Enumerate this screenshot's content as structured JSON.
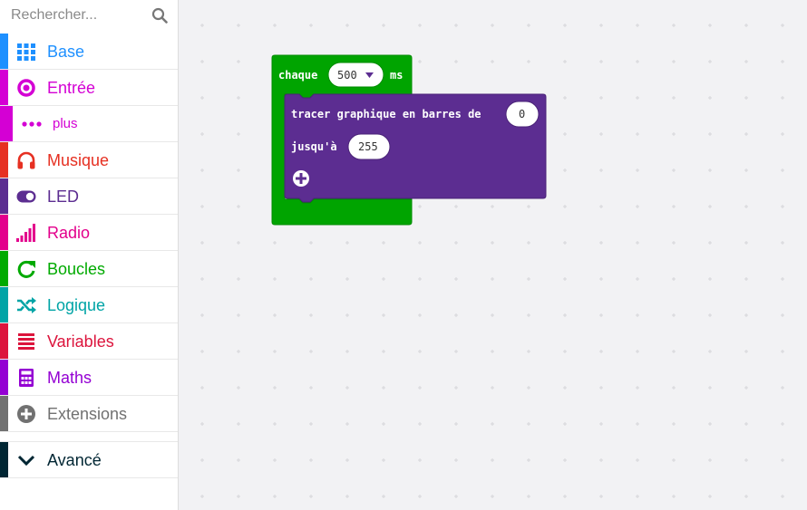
{
  "search": {
    "placeholder": "Rechercher..."
  },
  "categories": [
    {
      "label": "Base",
      "color": "#1e90ff",
      "icon": "grid-icon"
    },
    {
      "label": "Entrée",
      "color": "#d400d4",
      "icon": "target-icon"
    },
    {
      "label": "plus",
      "color": "#d400d4",
      "icon": "more-dots-icon"
    },
    {
      "label": "Musique",
      "color": "#e63022",
      "icon": "headphones-icon"
    },
    {
      "label": "LED",
      "color": "#5c2d91",
      "icon": "toggle-icon"
    },
    {
      "label": "Radio",
      "color": "#e3008c",
      "icon": "signal-bars-icon"
    },
    {
      "label": "Boucles",
      "color": "#00aa00",
      "icon": "refresh-icon"
    },
    {
      "label": "Logique",
      "color": "#00a4a6",
      "icon": "shuffle-icon"
    },
    {
      "label": "Variables",
      "color": "#dc143c",
      "icon": "list-icon"
    },
    {
      "label": "Maths",
      "color": "#9400d3",
      "icon": "calculator-icon"
    },
    {
      "label": "Extensions",
      "color": "#717171",
      "icon": "plus-circle-icon"
    },
    {
      "label": "Avancé",
      "color": "#002633",
      "icon": "chevron-down-icon"
    }
  ],
  "blocks": {
    "every": {
      "label": "chaque",
      "value": "500",
      "unit": "ms",
      "color": "#00a400"
    },
    "plot": {
      "label": "tracer graphique en barres de",
      "value": "0",
      "upto_label": "jusqu'à",
      "upto_value": "255",
      "color": "#5c2d91"
    }
  }
}
